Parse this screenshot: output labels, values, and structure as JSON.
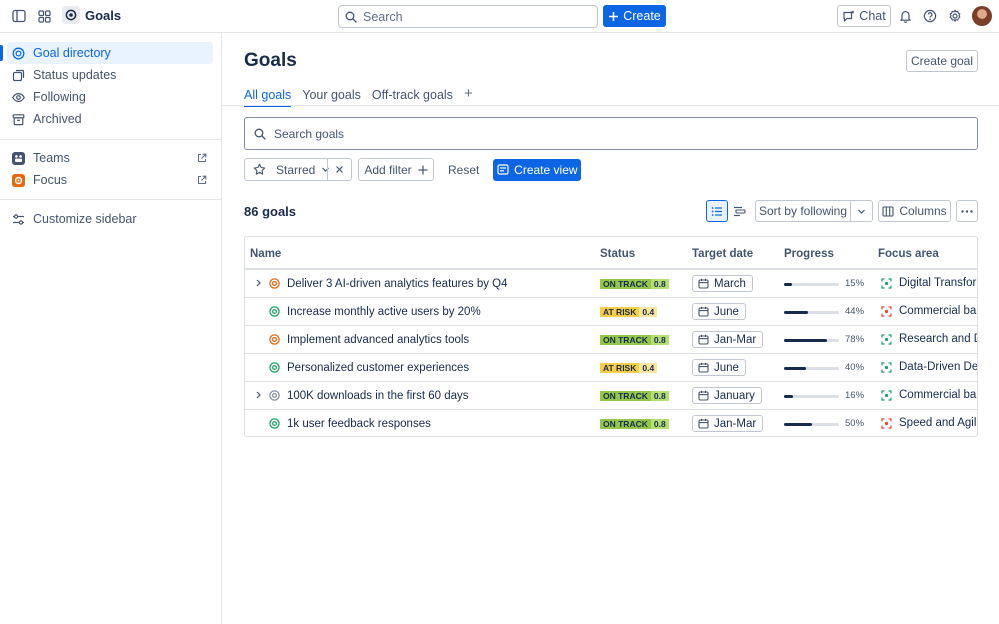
{
  "topbar": {
    "app_name": "Goals",
    "search_placeholder": "Search",
    "create_label": "Create",
    "chat_label": "Chat",
    "icons": [
      "sidebar-toggle-icon",
      "app-switcher-icon",
      "bell-icon",
      "help-icon",
      "settings-icon"
    ]
  },
  "sidebar": {
    "items": [
      {
        "label": "Goal directory",
        "icon": "target-icon",
        "active": true
      },
      {
        "label": "Status updates",
        "icon": "updates-icon"
      },
      {
        "label": "Following",
        "icon": "eye-icon"
      },
      {
        "label": "Archived",
        "icon": "archive-icon"
      }
    ],
    "external": [
      {
        "label": "Teams",
        "icon": "teams-icon"
      },
      {
        "label": "Focus",
        "icon": "focus-icon"
      }
    ],
    "customize_label": "Customize sidebar"
  },
  "main": {
    "title": "Goals",
    "create_goal_label": "Create goal",
    "tabs": [
      {
        "label": "All goals",
        "active": true
      },
      {
        "label": "Your goals"
      },
      {
        "label": "Off-track goals"
      }
    ],
    "search_placeholder": "Search goals",
    "filters": {
      "starred_label": "Starred",
      "add_filter_label": "Add filter",
      "reset_label": "Reset",
      "create_view_label": "Create view"
    },
    "count_label": "86 goals",
    "sort_label": "Sort by following",
    "columns_label": "Columns"
  },
  "table": {
    "headers": {
      "name": "Name",
      "status": "Status",
      "target": "Target date",
      "progress": "Progress",
      "focus": "Focus area"
    },
    "rows": [
      {
        "name": "Deliver 3 AI-driven analytics features by Q4",
        "expandable": true,
        "icon_color": "#e56910",
        "status": "ON TRACK",
        "score": "0.8",
        "date": "March",
        "progress": 15,
        "progress_label": "15%",
        "focus": "Digital Transformation",
        "focus_color": "#22a06b"
      },
      {
        "name": "Increase monthly active users by 20%",
        "expandable": false,
        "icon_color": "#22a06b",
        "status": "AT RISK",
        "score": "0.4",
        "date": "June",
        "progress": 44,
        "progress_label": "44%",
        "focus": "Commercial banking",
        "focus_color": "#e34935"
      },
      {
        "name": "Implement advanced analytics tools",
        "expandable": false,
        "icon_color": "#e56910",
        "status": "ON TRACK",
        "score": "0.8",
        "date": "Jan-Mar",
        "progress": 78,
        "progress_label": "78%",
        "focus": "Research and Development",
        "focus_color": "#22a06b"
      },
      {
        "name": "Personalized customer experiences",
        "expandable": false,
        "icon_color": "#22a06b",
        "status": "AT RISK",
        "score": "0.4",
        "date": "June",
        "progress": 40,
        "progress_label": "40%",
        "focus": "Data-Driven Decisions",
        "focus_color": "#22a06b"
      },
      {
        "name": "100K downloads in the first 60 days",
        "expandable": true,
        "icon_color": "#8590a2",
        "status": "ON TRACK",
        "score": "0.8",
        "date": "January",
        "progress": 16,
        "progress_label": "16%",
        "focus": "Commercial banking",
        "focus_color": "#22a06b"
      },
      {
        "name": "1k user feedback responses",
        "expandable": false,
        "icon_color": "#22a06b",
        "status": "ON TRACK",
        "score": "0.8",
        "date": "Jan-Mar",
        "progress": 50,
        "progress_label": "50%",
        "focus": "Speed and Agility",
        "focus_color": "#e34935"
      }
    ]
  },
  "colors": {
    "accent": "#0c66e4",
    "on_track_label": "#94c748",
    "on_track_score": "#b3df72",
    "at_risk_label": "#f5cd47",
    "at_risk_score": "#f8e6a0"
  }
}
